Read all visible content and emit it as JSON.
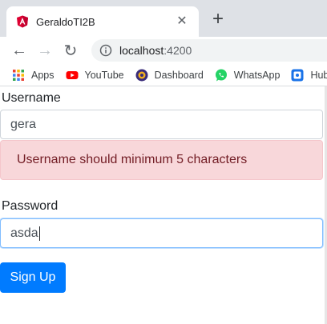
{
  "browser": {
    "tab": {
      "title": "GeraldoTI2B",
      "favicon": "angular-icon",
      "close_glyph": "✕"
    },
    "new_tab_glyph": "+",
    "toolbar": {
      "back_glyph": "←",
      "forward_glyph": "→",
      "reload_glyph": "↻",
      "url_host": "localhost",
      "url_port": ":4200"
    },
    "bookmarks": [
      {
        "label": "Apps",
        "icon": "apps-grid-icon"
      },
      {
        "label": "YouTube",
        "icon": "youtube-icon"
      },
      {
        "label": "Dashboard",
        "icon": "dashboard-icon"
      },
      {
        "label": "WhatsApp",
        "icon": "whatsapp-icon"
      },
      {
        "label": "Hub",
        "icon": "hub-icon"
      }
    ]
  },
  "form": {
    "username_label": "Username",
    "username_value": "gera",
    "username_error": "Username should minimum 5 characters",
    "password_label": "Password",
    "password_value": "asda",
    "submit_label": "Sign Up"
  },
  "colors": {
    "primary": "#007bff",
    "alert_bg": "#f8d7da",
    "alert_text": "#721c24",
    "angular_red": "#dd0031"
  }
}
